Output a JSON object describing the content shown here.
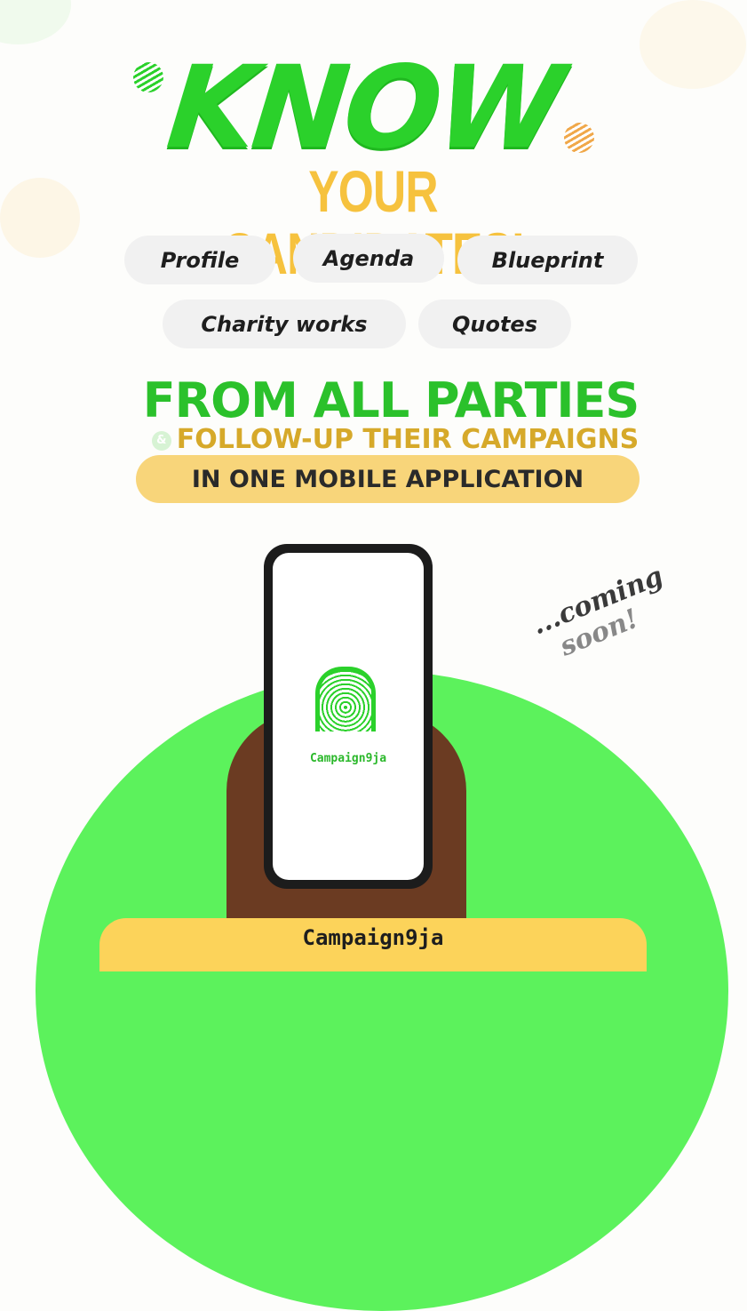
{
  "headline": {
    "word": "KNOW",
    "subtitle": "YOUR CANDIDATES’"
  },
  "features": [
    "Profile",
    "Agenda",
    "Blueprint",
    "Charity works",
    "Quotes"
  ],
  "tagline": {
    "main": "FROM ALL PARTIES",
    "amp": "&",
    "follow": "FOLLOW-UP THEIR CAMPAIGNS",
    "banner": "IN ONE MOBILE APPLICATION"
  },
  "phone": {
    "app_name": "Campaign9ja"
  },
  "coming_soon": {
    "line1": "...coming",
    "line2": "soon!"
  },
  "footer": {
    "brand": "Campaign9ja"
  },
  "colors": {
    "green": "#2bd12b",
    "yellow": "#f6c23e",
    "banner": "#f8d57a",
    "circle": "#5cf25c"
  }
}
